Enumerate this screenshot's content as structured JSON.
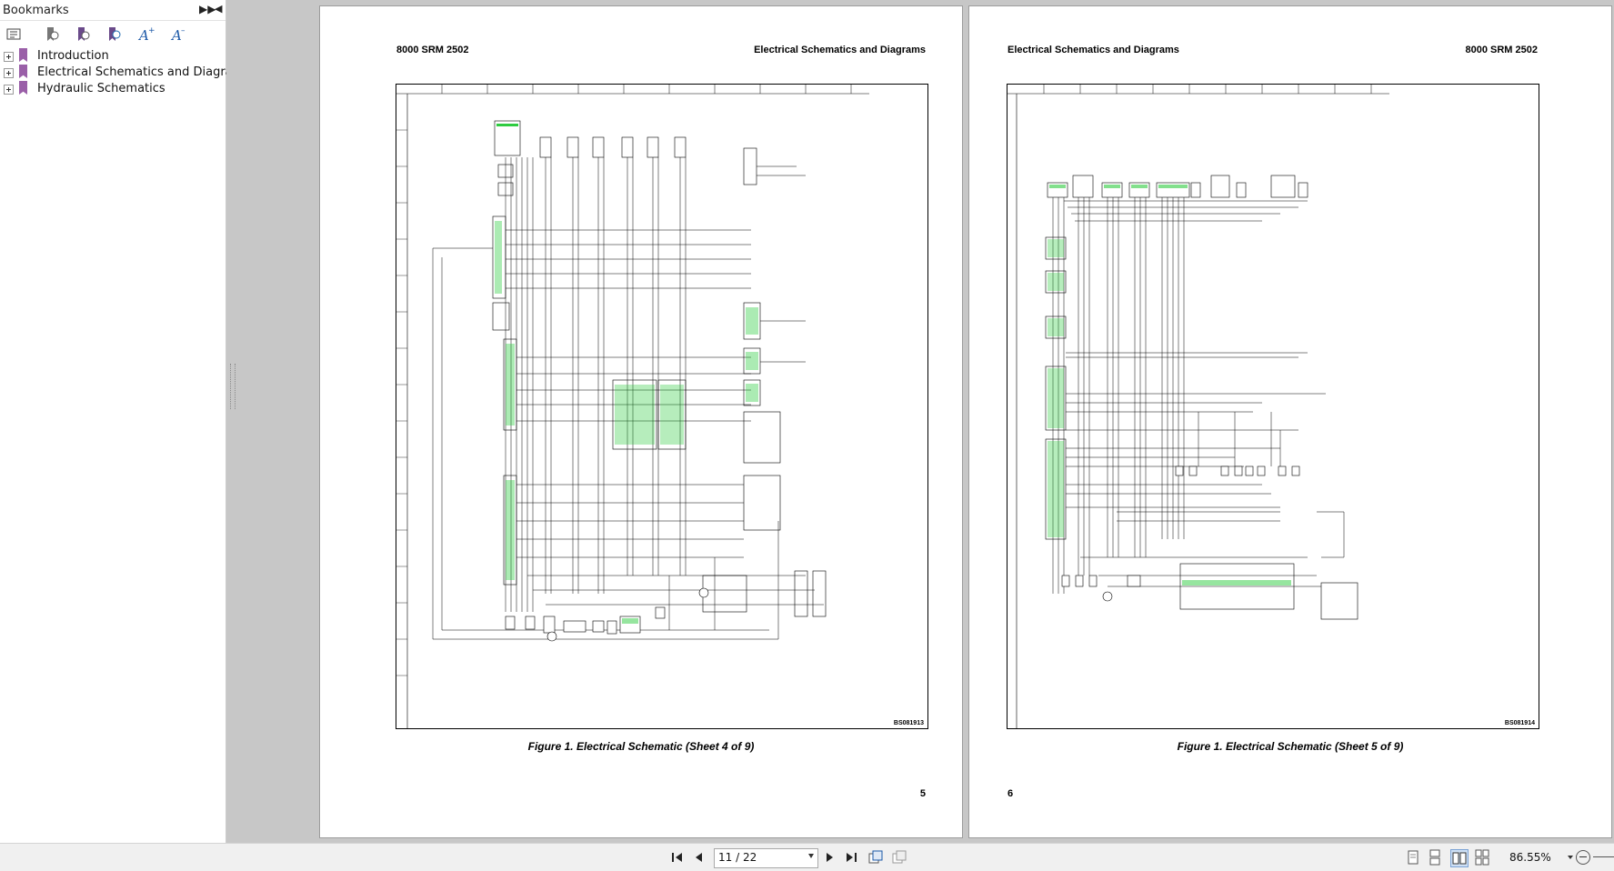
{
  "bookmarks": {
    "title": "Bookmarks",
    "expand_icon": "double-chevron-right-icon",
    "collapse_icon": "triangle-left-icon",
    "toolbar": [
      {
        "name": "bookmark-options-icon"
      },
      {
        "name": "expand-bookmark-icon"
      },
      {
        "name": "new-bookmark-icon"
      },
      {
        "name": "find-bookmark-icon"
      },
      {
        "name": "increase-text-size-icon"
      },
      {
        "name": "decrease-text-size-icon"
      }
    ],
    "items": [
      {
        "label": "Introduction"
      },
      {
        "label": "Electrical Schematics and Diagrams"
      },
      {
        "label": "Hydraulic Schematics"
      }
    ]
  },
  "pages": {
    "left": {
      "header_left": "8000 SRM 2502",
      "header_right": "Electrical Schematics and Diagrams",
      "figure_id": "BS081913",
      "caption": "Figure 1. Electrical Schematic (Sheet 4 of 9)",
      "page_number": "5"
    },
    "right": {
      "header_left": "Electrical Schematics and Diagrams",
      "header_right": "8000 SRM 2502",
      "figure_id": "BS081914",
      "caption": "Figure 1. Electrical Schematic (Sheet 5 of 9)",
      "page_number": "6"
    }
  },
  "toolbar": {
    "page_indicator": "11 / 22",
    "zoom": "86.55%",
    "accent_color": "#9a5fa8",
    "wire_color": "#000000",
    "label_color": "#2ecc40"
  }
}
